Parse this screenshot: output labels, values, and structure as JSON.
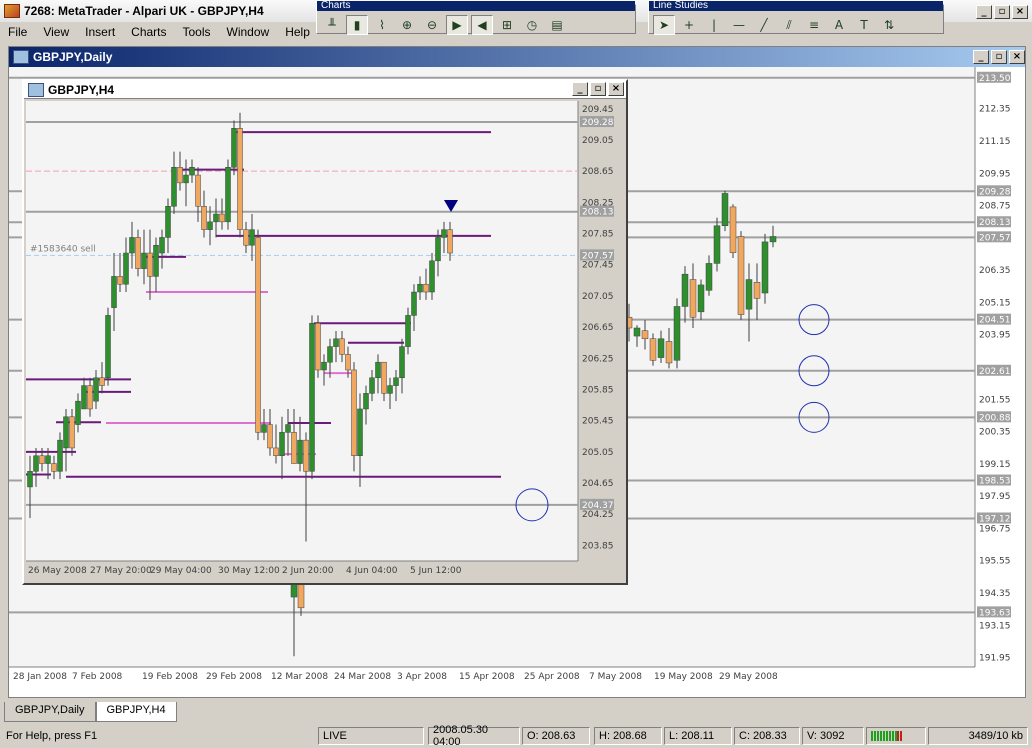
{
  "window": {
    "title": "7268: MetaTrader - Alpari UK - GBPJPY,H4"
  },
  "menu": [
    "File",
    "View",
    "Insert",
    "Charts",
    "Tools",
    "Window",
    "Help"
  ],
  "toolbars": {
    "charts_title": "Charts",
    "line_studies_title": "Line Studies"
  },
  "daily": {
    "title": "GBPJPY,Daily",
    "price_axis": [
      "212.35",
      "211.15",
      "209.95",
      "208.75",
      "206.35",
      "205.15",
      "203.95",
      "201.55",
      "200.35",
      "199.15",
      "197.95",
      "196.75",
      "195.55",
      "194.35",
      "193.15",
      "191.95"
    ],
    "price_labels": [
      "213.50",
      "209.28",
      "208.13",
      "207.57",
      "204.51",
      "202.61",
      "200.88",
      "198.53",
      "197.12",
      "193.63"
    ],
    "time_axis": [
      "28 Jan 2008",
      "7 Feb 2008",
      "19 Feb 2008",
      "29 Feb 2008",
      "12 Mar 2008",
      "24 Mar 2008",
      "3 Apr 2008",
      "15 Apr 2008",
      "25 Apr 2008",
      "7 May 2008",
      "19 May 2008",
      "29 May 2008"
    ]
  },
  "h4": {
    "title": "GBPJPY,H4",
    "order_label": "#1583640 sell",
    "price_axis": [
      "209.45",
      "209.05",
      "208.65",
      "208.25",
      "207.85",
      "207.45",
      "207.05",
      "206.65",
      "206.25",
      "205.85",
      "205.45",
      "205.05",
      "204.65",
      "204.25",
      "203.85"
    ],
    "price_labels": [
      "209.28",
      "208.13",
      "207.57",
      "204.37"
    ],
    "time_axis": [
      "26 May 2008",
      "27 May 20:00",
      "29 May 04:00",
      "30 May 12:00",
      "2 Jun 20:00",
      "4 Jun 04:00",
      "5 Jun 12:00"
    ]
  },
  "tabs": [
    "GBPJPY,Daily",
    "GBPJPY,H4"
  ],
  "status": {
    "help": "For Help, press F1",
    "profile": "LIVE",
    "datetime": "2008.05.30 04:00",
    "open": "O: 208.63",
    "high": "H: 208.68",
    "low": "L: 208.11",
    "close": "C: 208.33",
    "volume": "V: 3092",
    "traffic": "3489/10 kb"
  },
  "colors": {
    "bull": "#2f8f2f",
    "bear": "#f0a860",
    "level": "#a0a0a0",
    "purple": "#6a1a7a",
    "pink": "#e070d0",
    "circle": "#2030b0"
  }
}
